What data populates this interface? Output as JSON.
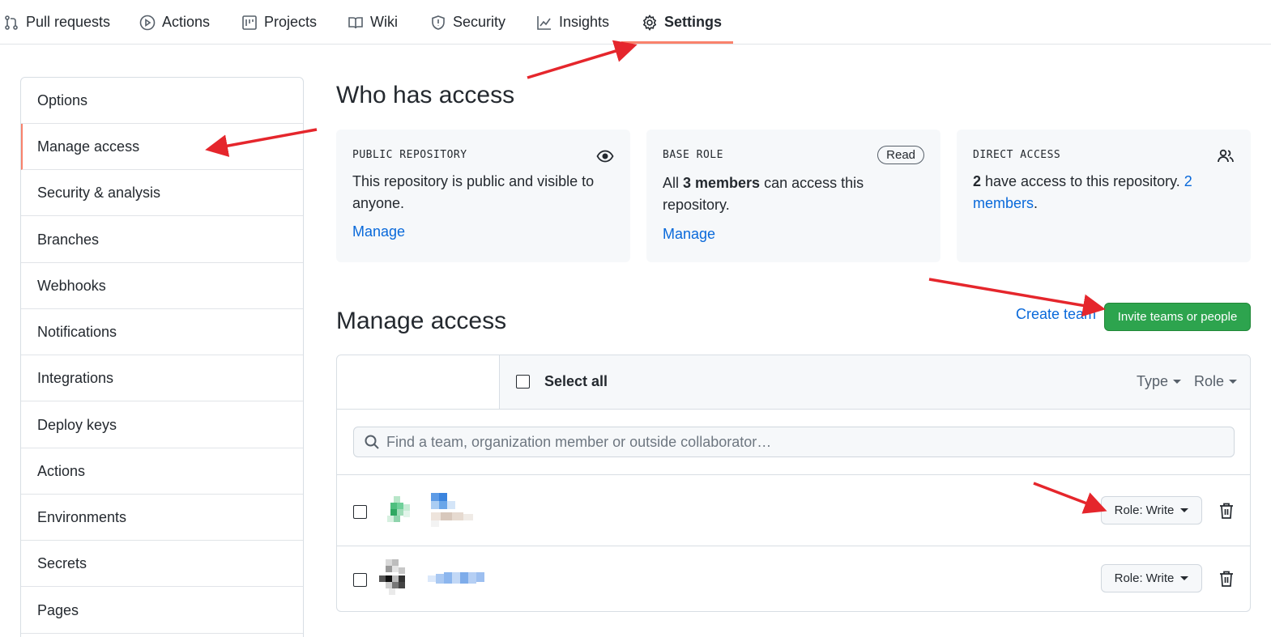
{
  "nav": {
    "tabs": [
      {
        "label": "Pull requests",
        "icon": "pull-request-icon"
      },
      {
        "label": "Actions",
        "icon": "play-icon"
      },
      {
        "label": "Projects",
        "icon": "project-icon"
      },
      {
        "label": "Wiki",
        "icon": "book-icon"
      },
      {
        "label": "Security",
        "icon": "shield-icon"
      },
      {
        "label": "Insights",
        "icon": "graph-icon"
      },
      {
        "label": "Settings",
        "icon": "gear-icon",
        "active": true
      }
    ]
  },
  "sidebar": {
    "items": [
      {
        "label": "Options"
      },
      {
        "label": "Manage access",
        "active": true
      },
      {
        "label": "Security & analysis"
      },
      {
        "label": "Branches"
      },
      {
        "label": "Webhooks"
      },
      {
        "label": "Notifications"
      },
      {
        "label": "Integrations"
      },
      {
        "label": "Deploy keys"
      },
      {
        "label": "Actions"
      },
      {
        "label": "Environments"
      },
      {
        "label": "Secrets"
      },
      {
        "label": "Pages"
      }
    ]
  },
  "who_has_access": {
    "title": "Who has access",
    "public_repo": {
      "label": "PUBLIC REPOSITORY",
      "text": "This repository is public and visible to anyone.",
      "link": "Manage",
      "icon": "eye-icon"
    },
    "base_role": {
      "label": "BASE ROLE",
      "badge": "Read",
      "text_pre": "All ",
      "text_bold": "3 members",
      "text_post": " can access this repository.",
      "link": "Manage"
    },
    "direct_access": {
      "label": "DIRECT ACCESS",
      "count": "2",
      "text": " have access to this repository. ",
      "link": "2 members",
      "suffix": ".",
      "icon": "people-icon"
    }
  },
  "manage_access": {
    "title": "Manage access",
    "create_team": "Create team",
    "invite_button": "Invite teams or people",
    "select_all": "Select all",
    "filter_type": "Type",
    "filter_role": "Role",
    "search_placeholder": "Find a team, organization member or outside collaborator…",
    "members": [
      {
        "role_prefix": "Role:",
        "role": "Write"
      },
      {
        "role_prefix": "Role:",
        "role": "Write"
      }
    ]
  },
  "colors": {
    "accent_underline": "#f9826c",
    "link": "#0969da",
    "primary_button": "#2da44e",
    "annotation_arrow": "#e5262c"
  }
}
